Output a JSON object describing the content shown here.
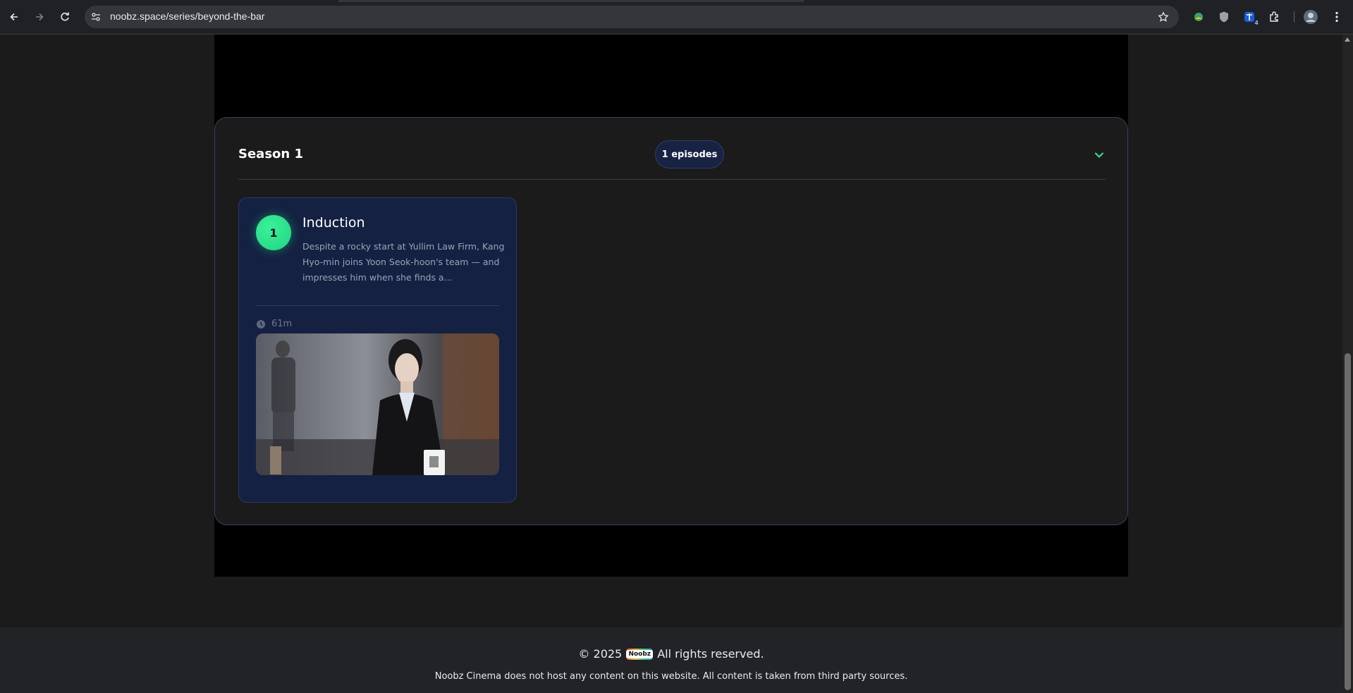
{
  "browser": {
    "url": "noobz.space/series/beyond-the-bar",
    "extension_badge": "4"
  },
  "season": {
    "title": "Season 1",
    "episode_count": "1 episodes"
  },
  "episodes": [
    {
      "number": "1",
      "title": "Induction",
      "description": "Despite a rocky start at Yullim Law Firm, Kang Hyo-min joins Yoon Seok-hoon's team — and impresses him when she finds a...",
      "duration": "61m"
    }
  ],
  "footer": {
    "copyright_prefix": "© 2025",
    "logo_text": "Noobz",
    "copyright_suffix": "All rights reserved.",
    "disclaimer": "Noobz Cinema does not host any content on this website. All content is taken from third party sources."
  },
  "colors": {
    "accent_green": "#2ce38a",
    "card_bg": "#142142",
    "page_bg": "#1b1b1c"
  }
}
